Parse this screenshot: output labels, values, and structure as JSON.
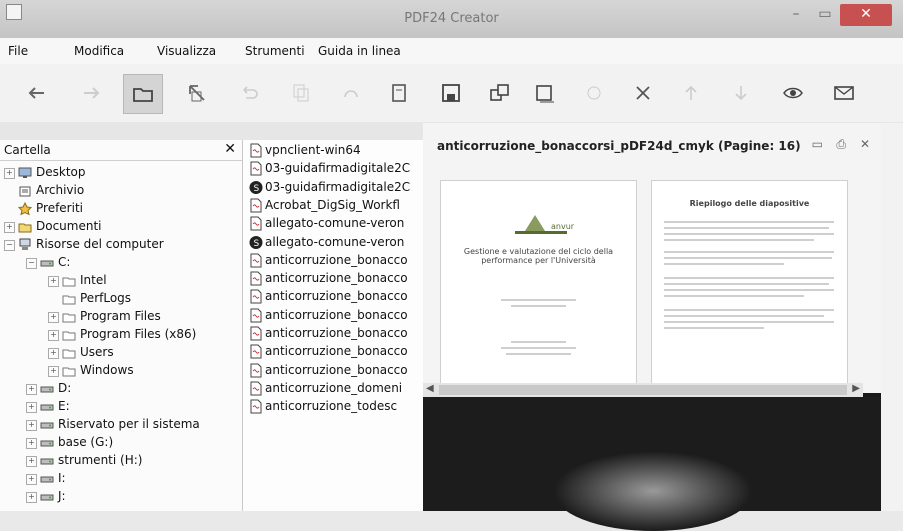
{
  "window": {
    "title": "PDF24 Creator",
    "min_glyph": "–",
    "max_glyph": "▭",
    "close_glyph": "✕"
  },
  "menu": [
    "File",
    "Modifica",
    "Visualizza",
    "Strumenti",
    "Guida in linea"
  ],
  "toolbar_icons": [
    "back-icon",
    "forward-icon",
    "open-folder-icon",
    "import-icon",
    "undo-icon",
    "copy-icon",
    "paste-icon",
    "save-icon",
    "save-as-icon",
    "merge-icon",
    "page-icon",
    "split-icon",
    "delete-icon",
    "move-up-icon",
    "move-down-icon",
    "preview-icon",
    "email-icon"
  ],
  "left_panel": {
    "title": "Cartella",
    "close": "✕",
    "tree": [
      {
        "label": "Desktop",
        "icon": "desktop-icon",
        "level": 0,
        "exp": "+"
      },
      {
        "label": "Archivio",
        "icon": "archive-icon",
        "level": 0,
        "exp": ""
      },
      {
        "label": "Preferiti",
        "icon": "star-icon",
        "level": 0,
        "exp": ""
      },
      {
        "label": "Documenti",
        "icon": "documents-folder-icon",
        "level": 0,
        "exp": "+"
      },
      {
        "label": "Risorse del computer",
        "icon": "computer-icon",
        "level": 0,
        "exp": "−"
      },
      {
        "label": "C:",
        "icon": "drive-icon",
        "level": 1,
        "exp": "−"
      },
      {
        "label": "Intel",
        "icon": "folder-icon",
        "level": 2,
        "exp": "+"
      },
      {
        "label": "PerfLogs",
        "icon": "folder-icon",
        "level": 2,
        "exp": ""
      },
      {
        "label": "Program Files",
        "icon": "folder-icon",
        "level": 2,
        "exp": "+"
      },
      {
        "label": "Program Files (x86)",
        "icon": "folder-icon",
        "level": 2,
        "exp": "+"
      },
      {
        "label": "Users",
        "icon": "folder-icon",
        "level": 2,
        "exp": "+"
      },
      {
        "label": "Windows",
        "icon": "folder-icon",
        "level": 2,
        "exp": "+"
      },
      {
        "label": "D:",
        "icon": "drive-icon",
        "level": 1,
        "exp": "+"
      },
      {
        "label": "E:",
        "icon": "drive-icon",
        "level": 1,
        "exp": "+"
      },
      {
        "label": "Riservato per il sistema",
        "icon": "drive-icon",
        "level": 1,
        "exp": "+"
      },
      {
        "label": "base (G:)",
        "icon": "drive-icon",
        "level": 1,
        "exp": "+"
      },
      {
        "label": "strumenti (H:)",
        "icon": "drive-icon",
        "level": 1,
        "exp": "+"
      },
      {
        "label": "I:",
        "icon": "drive-icon",
        "level": 1,
        "exp": "+"
      },
      {
        "label": "J:",
        "icon": "drive-icon",
        "level": 1,
        "exp": "+"
      }
    ]
  },
  "files": [
    {
      "name": "vpnclient-win64",
      "icon": "pdf-file-icon"
    },
    {
      "name": "03-guidafirmadigitale2C",
      "icon": "pdf-file-icon"
    },
    {
      "name": "03-guidafirmadigitale2C",
      "icon": "pdf-signed-icon"
    },
    {
      "name": "Acrobat_DigSig_Workfl",
      "icon": "pdf-file-icon"
    },
    {
      "name": "allegato-comune-veron",
      "icon": "pdf-file-icon"
    },
    {
      "name": "allegato-comune-veron",
      "icon": "pdf-signed-icon"
    },
    {
      "name": "anticorruzione_bonacco",
      "icon": "pdf-file-icon"
    },
    {
      "name": "anticorruzione_bonacco",
      "icon": "pdf-file-icon"
    },
    {
      "name": "anticorruzione_bonacco",
      "icon": "pdf-file-icon"
    },
    {
      "name": "anticorruzione_bonacco",
      "icon": "pdf-file-icon"
    },
    {
      "name": "anticorruzione_bonacco",
      "icon": "pdf-file-icon"
    },
    {
      "name": "anticorruzione_bonacco",
      "icon": "pdf-file-icon"
    },
    {
      "name": "anticorruzione_bonacco",
      "icon": "pdf-file-icon"
    },
    {
      "name": "anticorruzione_domeni",
      "icon": "pdf-file-icon"
    },
    {
      "name": "anticorruzione_todesc",
      "icon": "pdf-file-icon"
    }
  ],
  "preview": {
    "title": "anticorruzione_bonaccorsi_pDF24d_cmyk (Pagine: 16)",
    "page_left": {
      "logo": "anvur",
      "heading": "Gestione e valutazione del ciclo della performance per l'Università"
    },
    "page_right": {
      "heading": "Riepilogo delle diapositive"
    }
  }
}
